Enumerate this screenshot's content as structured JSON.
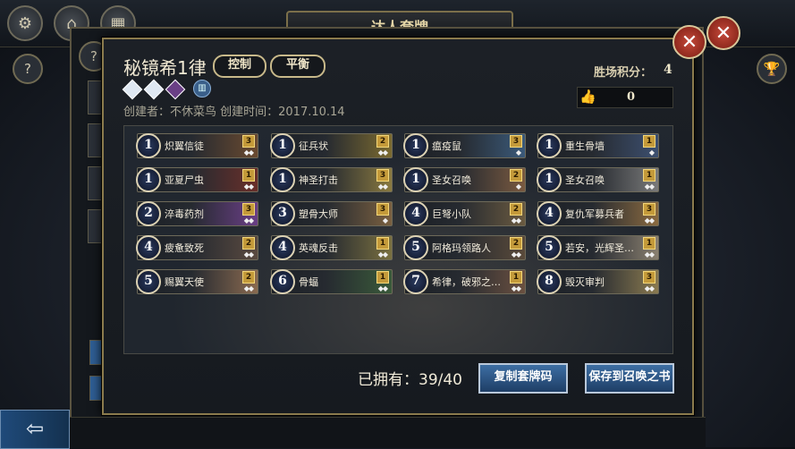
{
  "window": {
    "title": "达人套牌"
  },
  "deck": {
    "name": "秘镜希1律",
    "tags": [
      "控制",
      "平衡"
    ],
    "creator_line": "创建者：不休菜鸟  创建时间：2017.10.14",
    "win_score_label": "胜场积分：",
    "win_score_value": "4",
    "likes": "0",
    "gem_colors": [
      "#dfe8f2",
      "#dfe8f2",
      "#6a3f86"
    ]
  },
  "cards": [
    {
      "cost": "1",
      "name": "炽翼信徒",
      "qty": "3",
      "rarity": "◆◆",
      "color": "#6a4a30"
    },
    {
      "cost": "1",
      "name": "征兵状",
      "qty": "2",
      "rarity": "◆◆",
      "color": "#7b6a30"
    },
    {
      "cost": "1",
      "name": "瘟疫鼠",
      "qty": "3",
      "rarity": "◆",
      "color": "#3b5a7a"
    },
    {
      "cost": "1",
      "name": "重生骨墙",
      "qty": "1",
      "rarity": "◆",
      "color": "#3d5070"
    },
    {
      "cost": "1",
      "name": "亚夏尸虫",
      "qty": "1",
      "rarity": "◆◆",
      "color": "#6a2f2a"
    },
    {
      "cost": "1",
      "name": "神圣打击",
      "qty": "3",
      "rarity": "◆◆",
      "color": "#8a7a40"
    },
    {
      "cost": "1",
      "name": "圣女召唤",
      "qty": "2",
      "rarity": "◆",
      "color": "#7a5a40"
    },
    {
      "cost": "1",
      "name": "圣女召唤",
      "qty": "1",
      "rarity": "◆◆",
      "color": "#7a7a7a"
    },
    {
      "cost": "2",
      "name": "淬毒药剂",
      "qty": "3",
      "rarity": "◆◆",
      "color": "#6a3f86"
    },
    {
      "cost": "3",
      "name": "塑骨大师",
      "qty": "3",
      "rarity": "◆",
      "color": "#7a6040"
    },
    {
      "cost": "4",
      "name": "巨弩小队",
      "qty": "2",
      "rarity": "◆◆",
      "color": "#6a5a40"
    },
    {
      "cost": "4",
      "name": "复仇军募兵者",
      "qty": "3",
      "rarity": "◆◆",
      "color": "#8a6a40"
    },
    {
      "cost": "4",
      "name": "疲惫致死",
      "qty": "2",
      "rarity": "◆◆",
      "color": "#5a4a40"
    },
    {
      "cost": "4",
      "name": "英魂反击",
      "qty": "1",
      "rarity": "◆◆",
      "color": "#7a7040"
    },
    {
      "cost": "5",
      "name": "阿格玛领路人",
      "qty": "2",
      "rarity": "◆◆",
      "color": "#5a4a3a"
    },
    {
      "cost": "5",
      "name": "若安，光辉圣…",
      "qty": "1",
      "rarity": "◆◆",
      "color": "#8a8070"
    },
    {
      "cost": "5",
      "name": "赐翼天使",
      "qty": "2",
      "rarity": "◆◆",
      "color": "#8a6a50"
    },
    {
      "cost": "6",
      "name": "骨蝠",
      "qty": "1",
      "rarity": "◆◆",
      "color": "#3a5a3a"
    },
    {
      "cost": "7",
      "name": "希律，破邪之…",
      "qty": "1",
      "rarity": "◆◆",
      "color": "#6a5040"
    },
    {
      "cost": "8",
      "name": "毁灭审判",
      "qty": "3",
      "rarity": "◆◆",
      "color": "#8a7a50"
    }
  ],
  "footer": {
    "owned": "已拥有：39/40",
    "copy_button": "复制套牌码",
    "save_button": "保存到召唤之书"
  },
  "icons": {
    "settings": "gear-icon",
    "back": "back-arrow-icon",
    "close": "close-icon",
    "help": "help-icon",
    "trophy": "trophy-icon",
    "thumbs_up": "thumbs-up-icon"
  }
}
